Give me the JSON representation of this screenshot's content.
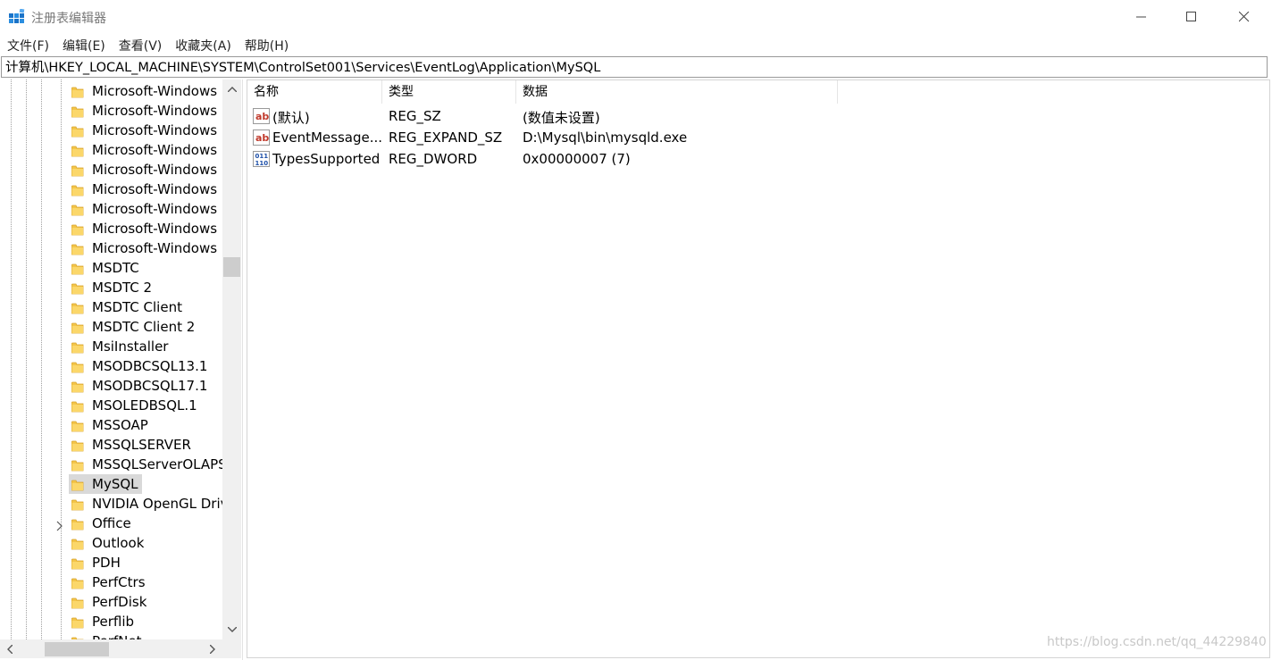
{
  "window": {
    "title": "注册表编辑器"
  },
  "menu": [
    "文件(F)",
    "编辑(E)",
    "查看(V)",
    "收藏夹(A)",
    "帮助(H)"
  ],
  "address": "计算机\\HKEY_LOCAL_MACHINE\\SYSTEM\\ControlSet001\\Services\\EventLog\\Application\\MySQL",
  "tree": {
    "items": [
      {
        "label": "Microsoft-Windows"
      },
      {
        "label": "Microsoft-Windows"
      },
      {
        "label": "Microsoft-Windows"
      },
      {
        "label": "Microsoft-Windows"
      },
      {
        "label": "Microsoft-Windows"
      },
      {
        "label": "Microsoft-Windows"
      },
      {
        "label": "Microsoft-Windows"
      },
      {
        "label": "Microsoft-Windows"
      },
      {
        "label": "Microsoft-Windows"
      },
      {
        "label": "MSDTC"
      },
      {
        "label": "MSDTC 2"
      },
      {
        "label": "MSDTC Client"
      },
      {
        "label": "MSDTC Client 2"
      },
      {
        "label": "MsiInstaller"
      },
      {
        "label": "MSODBCSQL13.1"
      },
      {
        "label": "MSODBCSQL17.1"
      },
      {
        "label": "MSOLEDBSQL.1"
      },
      {
        "label": "MSSOAP"
      },
      {
        "label": "MSSQLSERVER"
      },
      {
        "label": "MSSQLServerOLAPService"
      },
      {
        "label": "MySQL",
        "selected": true
      },
      {
        "label": "NVIDIA OpenGL Driver"
      },
      {
        "label": "Office",
        "expandable": true
      },
      {
        "label": "Outlook"
      },
      {
        "label": "PDH"
      },
      {
        "label": "PerfCtrs"
      },
      {
        "label": "PerfDisk"
      },
      {
        "label": "Perflib"
      },
      {
        "label": "PerfNet"
      }
    ]
  },
  "values": {
    "columns": {
      "name": "名称",
      "type": "类型",
      "data": "数据"
    },
    "rows": [
      {
        "icon": "string-value-icon",
        "name": "(默认)",
        "type": "REG_SZ",
        "data": "(数值未设置)"
      },
      {
        "icon": "string-value-icon",
        "name": "EventMessage...",
        "type": "REG_EXPAND_SZ",
        "data": "D:\\Mysql\\bin\\mysqld.exe"
      },
      {
        "icon": "binary-value-icon",
        "name": "TypesSupported",
        "type": "REG_DWORD",
        "data": "0x00000007 (7)"
      }
    ]
  },
  "watermark": "https://blog.csdn.net/qq_44229840"
}
